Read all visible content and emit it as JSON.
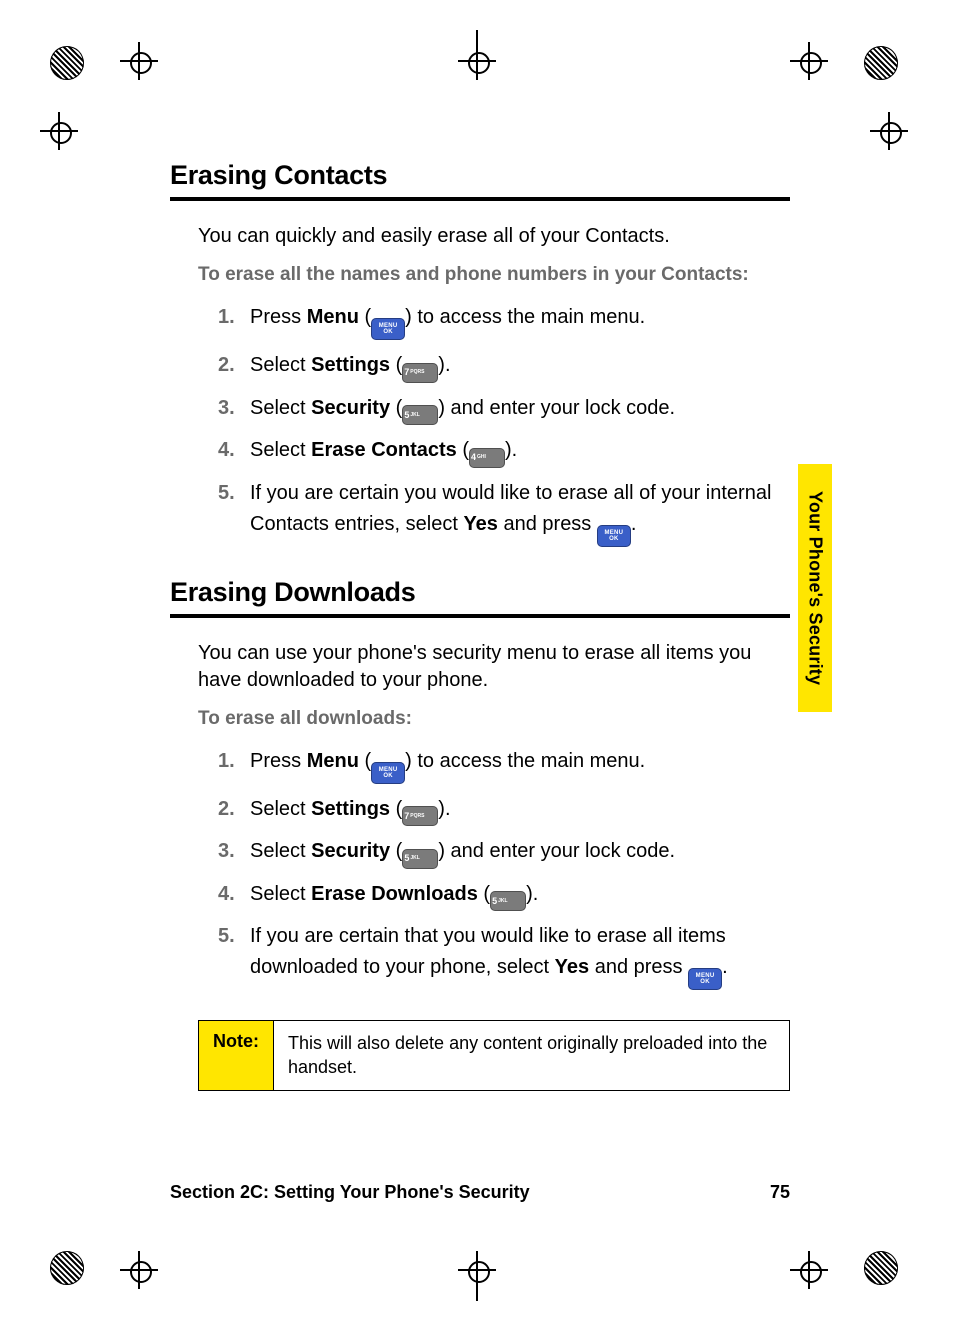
{
  "sideTab": "Your Phone's Security",
  "footer": {
    "section": "Section 2C:  Setting Your Phone's Security",
    "page": "75"
  },
  "note": {
    "label": "Note:",
    "text": "This will also delete any content originally preloaded into the handset."
  },
  "sections": [
    {
      "title": "Erasing Contacts",
      "intro": "You can quickly and easily erase all of your Contacts.",
      "subhead": "To erase all the names and phone numbers in your Contacts:",
      "steps": [
        {
          "n": "1.",
          "pre": "Press ",
          "bold": "Menu",
          "mid": " (",
          "key": "menu",
          "post": ") to access the main menu."
        },
        {
          "n": "2.",
          "pre": "Select ",
          "bold": "Settings",
          "mid": " (",
          "key": "7",
          "post": ")."
        },
        {
          "n": "3.",
          "pre": "Select ",
          "bold": "Security",
          "mid": " (",
          "key": "5",
          "post": ") and enter your lock code."
        },
        {
          "n": "4.",
          "pre": "Select ",
          "bold": "Erase Contacts",
          "mid": " (",
          "key": "4",
          "post": ")."
        },
        {
          "n": "5.",
          "pre": "If you are certain you would like to erase all of your internal Contacts entries, select ",
          "bold": "Yes",
          "mid": " and press ",
          "key": "menu",
          "post": "."
        }
      ]
    },
    {
      "title": "Erasing Downloads",
      "intro": "You can use your phone's security menu to erase all items you have downloaded to your phone.",
      "subhead": "To erase all downloads:",
      "steps": [
        {
          "n": "1.",
          "pre": "Press ",
          "bold": "Menu",
          "mid": " (",
          "key": "menu",
          "post": ") to access the main menu."
        },
        {
          "n": "2.",
          "pre": "Select ",
          "bold": "Settings",
          "mid": " (",
          "key": "7",
          "post": ")."
        },
        {
          "n": "3.",
          "pre": "Select ",
          "bold": "Security",
          "mid": " (",
          "key": "5",
          "post": ") and enter your lock code."
        },
        {
          "n": "4.",
          "pre": "Select ",
          "bold": "Erase Downloads",
          "mid": " (",
          "key": "5",
          "post": ")."
        },
        {
          "n": "5.",
          "pre": "If you are certain that you would like to erase all items downloaded to your phone, select ",
          "bold": "Yes",
          "mid": " and press ",
          "key": "menu",
          "post": "."
        }
      ]
    }
  ],
  "keyLabels": {
    "menuTop": "MENU",
    "menuBottom": "OK",
    "4": {
      "d": "4",
      "l": "GHI"
    },
    "5": {
      "d": "5",
      "l": "JKL"
    },
    "7": {
      "d": "7",
      "l": "PQRS"
    }
  }
}
